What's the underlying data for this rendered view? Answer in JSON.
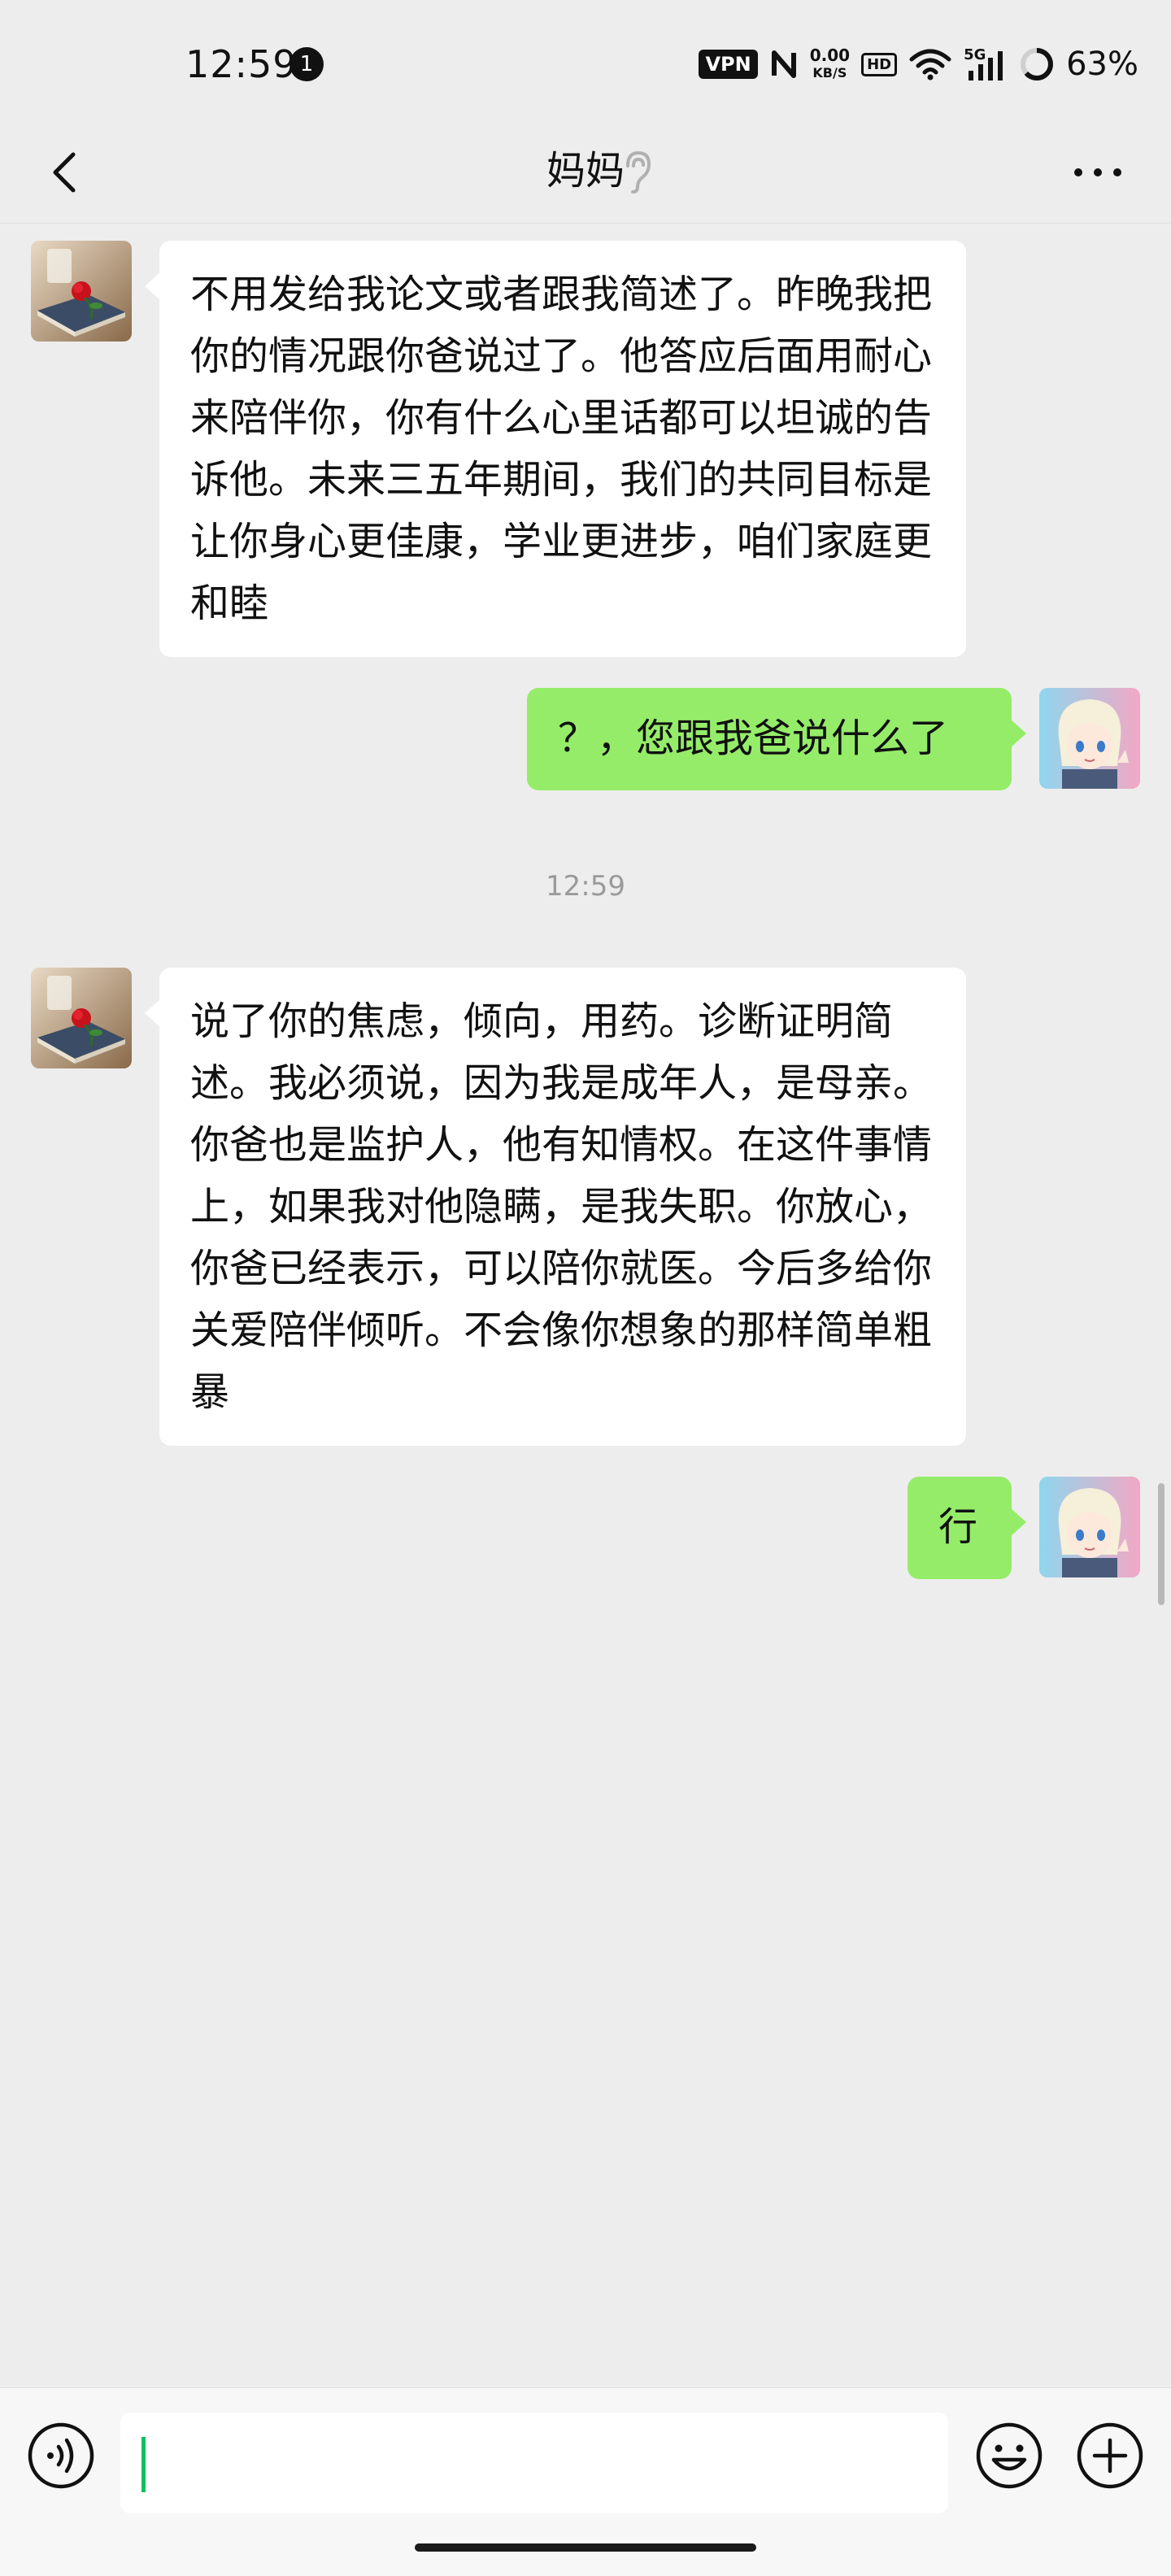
{
  "status_bar": {
    "time": "12:59",
    "notification_count": "1",
    "vpn_label": "VPN",
    "net_speed_value": "0.00",
    "net_speed_unit": "KB/S",
    "hd_label": "HD",
    "signal_label": "5G",
    "battery": "63%"
  },
  "header": {
    "title": "妈妈",
    "back_icon": "chevron-left-icon",
    "mode_icon": "ear-icon",
    "more_icon": "more-dots-icon"
  },
  "messages": [
    {
      "side": "in",
      "text": "不用发给我论文或者跟我简述了。昨晚我把你的情况跟你爸说过了。他答应后面用耐心来陪伴你，你有什么心里话都可以坦诚的告诉他。未来三五年期间，我们的共同目标是让你身心更佳康，学业更进步，咱们家庭更和睦"
    },
    {
      "side": "out",
      "text": "？，您跟我爸说什么了"
    },
    {
      "timestamp": "12:59"
    },
    {
      "side": "in",
      "text": "说了你的焦虑，倾向，用药。诊断证明简述。我必须说，因为我是成年人，是母亲。你爸也是监护人，他有知情权。在这件事情上，如果我对他隐瞒，是我失职。你放心，你爸已经表示，可以陪你就医。今后多给你关爱陪伴倾听。不会像你想象的那样简单粗暴"
    },
    {
      "side": "out",
      "text": "行"
    }
  ],
  "input_bar": {
    "voice_icon": "voice-icon",
    "emoji_icon": "emoji-icon",
    "plus_icon": "plus-icon"
  },
  "colors": {
    "background": "#ededed",
    "incoming_bubble": "#ffffff",
    "outgoing_bubble": "#95ec69",
    "caret": "#07c160"
  }
}
